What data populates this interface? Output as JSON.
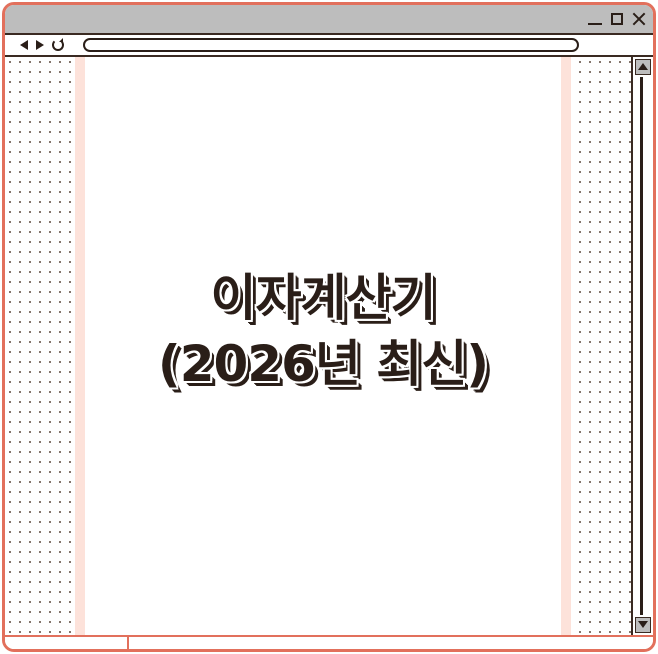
{
  "window": {
    "controls": {
      "minimize": "minimize-icon",
      "maximize": "maximize-icon",
      "close": "close-icon"
    }
  },
  "navbar": {
    "icons": {
      "back": "back-arrow-icon",
      "forward": "forward-arrow-icon",
      "reload": "reload-icon"
    },
    "address_value": ""
  },
  "content": {
    "title_line1": "이자계산기",
    "title_line2": "(2026년 최신)"
  },
  "colors": {
    "frame": "#e2705c",
    "titlebar": "#bdbdbd",
    "ink": "#2a1e18",
    "paper_edge": "#fde2da"
  }
}
